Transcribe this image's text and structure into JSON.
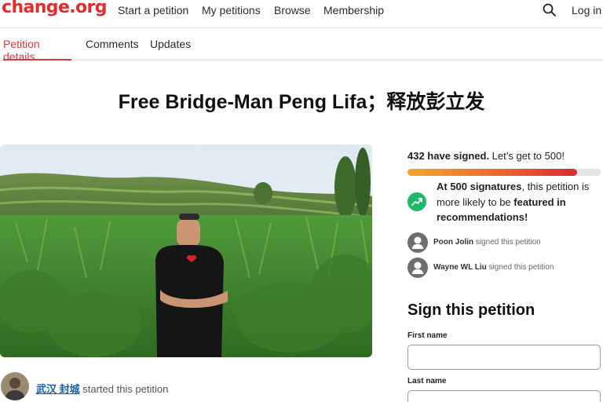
{
  "nav": {
    "logo": "change.org",
    "links": [
      "Start a petition",
      "My petitions",
      "Browse",
      "Membership"
    ],
    "login": "Log in"
  },
  "tabs": [
    "Petition details",
    "Comments",
    "Updates"
  ],
  "petition": {
    "title": "Free Bridge-Man Peng Lifa；释放彭立发",
    "starter_name": "武汉 封城",
    "starter_suffix": " started this petition"
  },
  "signatures": {
    "count_text": "432 have signed.",
    "goal_text": " Let’s get to 500!",
    "progress_fraction": 0.88
  },
  "milestone": {
    "part1": "At 500 signatures",
    "part2": ", this petition is more likely to be ",
    "part3": "featured in recommendations!"
  },
  "signers": [
    {
      "name": "Poon Jolin",
      "action": " signed this petition"
    },
    {
      "name": "Wayne WL Liu",
      "action": " signed this petition"
    }
  ],
  "form": {
    "heading": "Sign this petition",
    "first_name_label": "First name",
    "first_name_value": "",
    "last_name_label": "Last name",
    "last_name_value": ""
  },
  "colors": {
    "brand": "#e12d2d",
    "tab_active": "#d93b3b",
    "link": "#1a5fa8",
    "trend_icon": "#1fb866"
  },
  "icons": {
    "search": "search-icon",
    "trend": "trending-up-icon",
    "signer_avatar": "user-icon"
  }
}
